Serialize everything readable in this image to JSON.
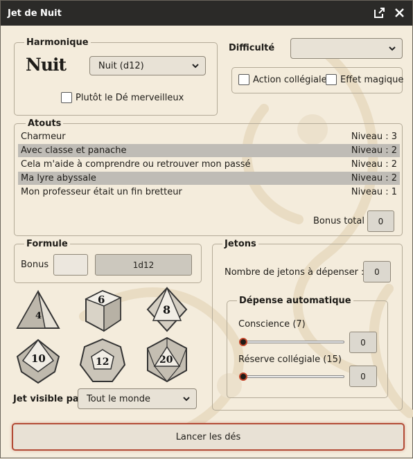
{
  "window": {
    "title": "Jet de Nuit"
  },
  "harmonique": {
    "legend": "Harmonique",
    "logo_text": "Nuit",
    "select_value": "Nuit (d12)",
    "checkbox_label": "Plutôt le Dé merveilleux"
  },
  "difficulte": {
    "label": "Difficulté",
    "select_value": ""
  },
  "options": {
    "action_collegiale": "Action collégiale",
    "effet_magique": "Effet magique"
  },
  "atouts": {
    "legend": "Atouts",
    "items": [
      {
        "name": "Charmeur",
        "level": "Niveau : 3",
        "highlighted": false
      },
      {
        "name": "Avec classe et panache",
        "level": "Niveau : 2",
        "highlighted": true
      },
      {
        "name": "Cela m'aide à comprendre ou retrouver mon passé",
        "level": "Niveau : 2",
        "highlighted": false
      },
      {
        "name": "Ma lyre abyssale",
        "level": "Niveau : 2",
        "highlighted": true
      },
      {
        "name": "Mon professeur était un fin bretteur",
        "level": "Niveau : 1",
        "highlighted": false
      }
    ],
    "bonus_total_label": "Bonus total",
    "bonus_total_value": "0"
  },
  "formule": {
    "legend": "Formule",
    "bonus_label": "Bonus",
    "bonus_value": "",
    "formula": "1d12"
  },
  "dice": [
    {
      "name": "d4-die",
      "label": "4"
    },
    {
      "name": "d6-die",
      "label": "6"
    },
    {
      "name": "d8-die",
      "label": "8"
    },
    {
      "name": "d10-die",
      "label": "10"
    },
    {
      "name": "d12-die",
      "label": "12"
    },
    {
      "name": "d20-die",
      "label": "20"
    }
  ],
  "visibility": {
    "label": "Jet visible par",
    "select_value": "Tout le monde"
  },
  "jetons": {
    "legend": "Jetons",
    "spend_label": "Nombre de jetons à dépenser :",
    "spend_value": "0",
    "auto": {
      "legend": "Dépense automatique",
      "conscience_label": "Conscience (7)",
      "conscience_value": "0",
      "reserve_label": "Réserve collégiale (15)",
      "reserve_value": "0"
    }
  },
  "roll_button": "Lancer les dés",
  "colors": {
    "accent": "#b34a35",
    "titlebar": "#2b2a28",
    "background": "#f4ecdc"
  }
}
